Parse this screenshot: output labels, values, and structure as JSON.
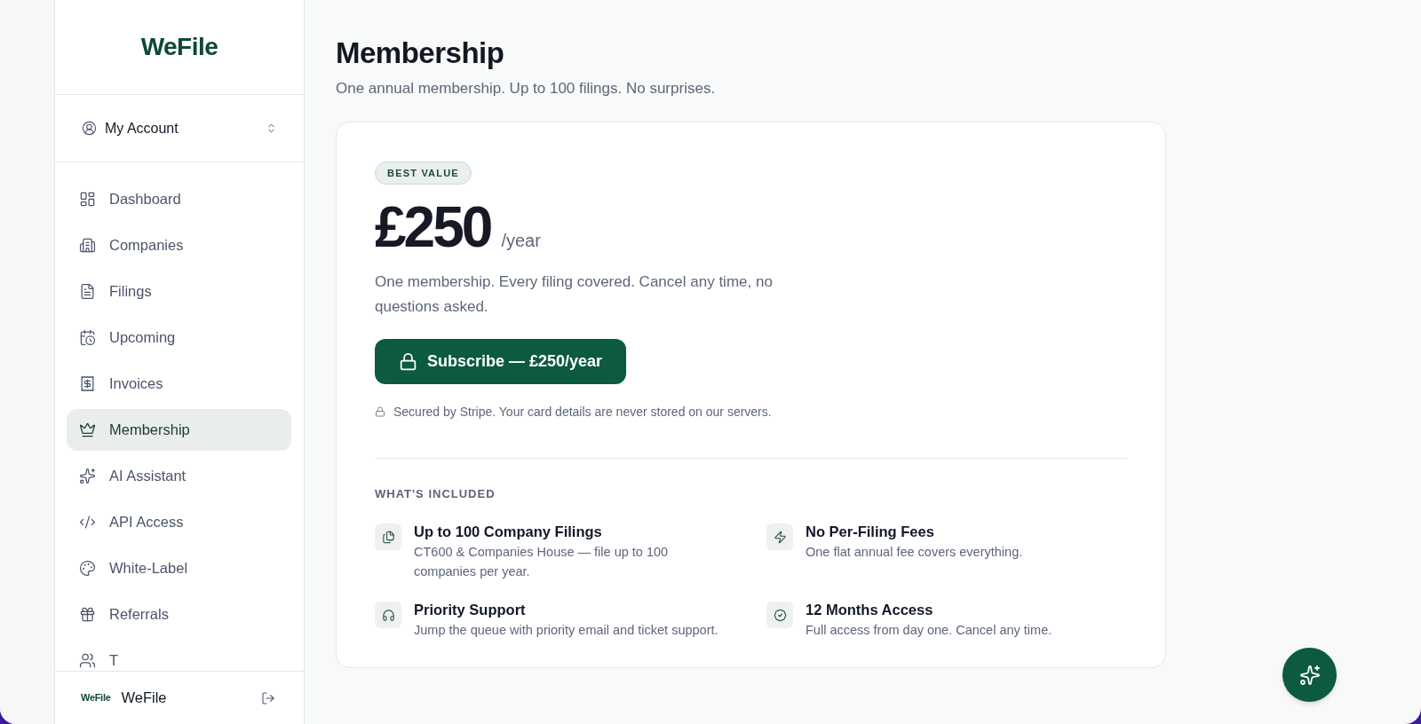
{
  "sidebar": {
    "logo": "WeFile",
    "account": {
      "label": "My Account"
    },
    "items": [
      {
        "label": "Dashboard",
        "selected": false
      },
      {
        "label": "Companies",
        "selected": false
      },
      {
        "label": "Filings",
        "selected": false
      },
      {
        "label": "Upcoming",
        "selected": false
      },
      {
        "label": "Invoices",
        "selected": false
      },
      {
        "label": "Membership",
        "selected": true
      },
      {
        "label": "AI Assistant",
        "selected": false
      },
      {
        "label": "API Access",
        "selected": false
      },
      {
        "label": "White-Label",
        "selected": false
      },
      {
        "label": "Referrals",
        "selected": false
      },
      {
        "label": "T",
        "selected": false
      }
    ],
    "footer": {
      "logo": "WeFile",
      "name": "WeFile"
    }
  },
  "page": {
    "title": "Membership",
    "subtitle": "One annual membership. Up to 100 filings. No surprises."
  },
  "plan": {
    "badge": "BEST VALUE",
    "price": "£250",
    "period": "/year",
    "description": "One membership. Every filing covered. Cancel any time, no questions asked.",
    "button": "Subscribe — £250/year",
    "security_note": "Secured by Stripe. Your card details are never stored on our servers.",
    "included_heading": "WHAT'S INCLUDED",
    "features": [
      {
        "title": "Up to 100 Company Filings",
        "description": "CT600 & Companies House — file up to 100 companies per year."
      },
      {
        "title": "No Per-Filing Fees",
        "description": "One flat annual fee covers everything."
      },
      {
        "title": "Priority Support",
        "description": "Jump the queue with priority email and ticket support."
      },
      {
        "title": "12 Months Access",
        "description": "Full access from day one. Cancel any time."
      }
    ]
  }
}
